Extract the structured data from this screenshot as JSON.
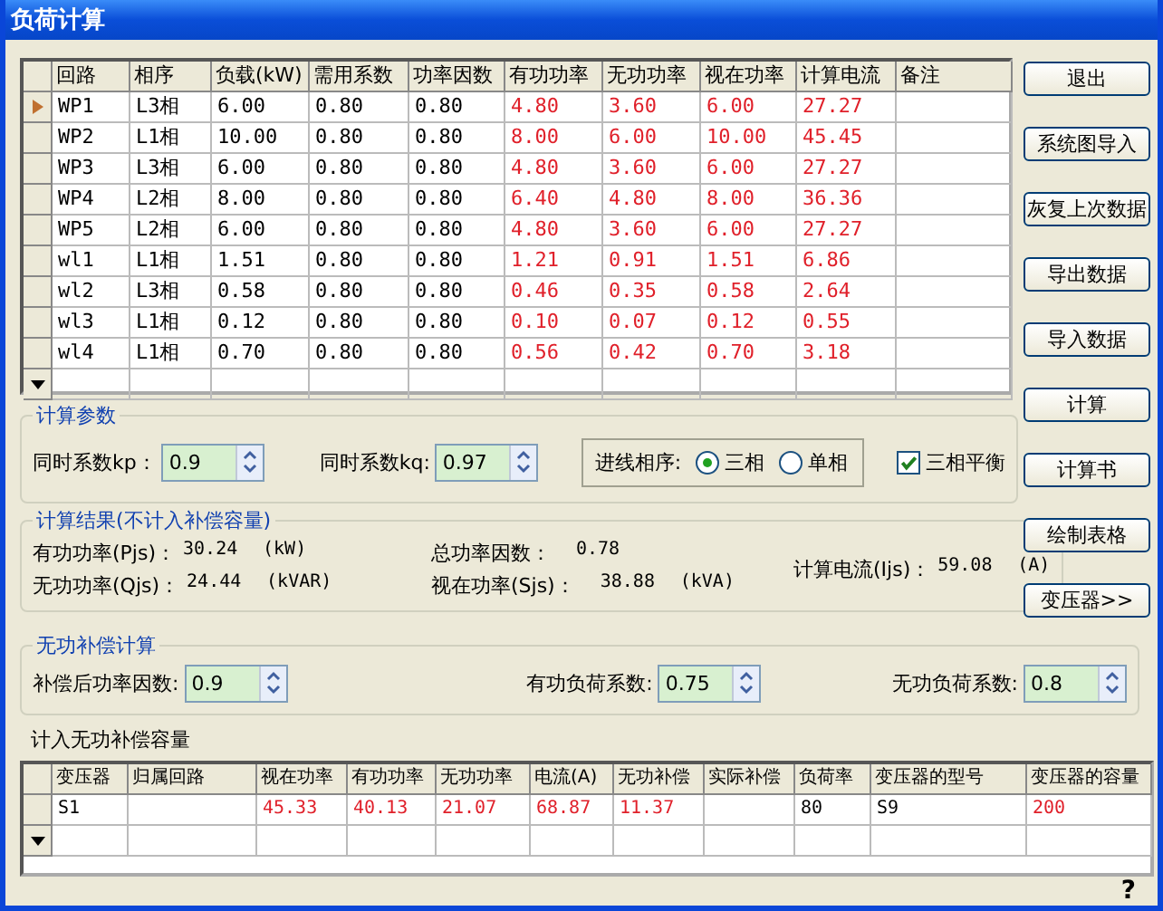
{
  "window": {
    "title": "负荷计算"
  },
  "load_table": {
    "columns": [
      {
        "label": "回路",
        "color": "#000000"
      },
      {
        "label": "相序",
        "color": "#000000"
      },
      {
        "label": "负载(kW)",
        "color": "#000000"
      },
      {
        "label": "需用系数",
        "color": "#000000"
      },
      {
        "label": "功率因数",
        "color": "#000000"
      },
      {
        "label": "有功功率",
        "color": "#e0202a"
      },
      {
        "label": "无功功率",
        "color": "#e0202a"
      },
      {
        "label": "视在功率",
        "color": "#e0202a"
      },
      {
        "label": "计算电流",
        "color": "#e0202a"
      },
      {
        "label": "备注"
      }
    ],
    "rows": [
      {
        "selected": true,
        "cells": [
          "WP1",
          "L3相",
          "6.00",
          "0.80",
          "0.80",
          "4.80",
          "3.60",
          "6.00",
          "27.27",
          null
        ]
      },
      {
        "selected": false,
        "cells": [
          "WP2",
          "L1相",
          "10.00",
          "0.80",
          "0.80",
          "8.00",
          "6.00",
          "10.00",
          "45.45",
          null
        ]
      },
      {
        "selected": false,
        "cells": [
          "WP3",
          "L3相",
          "6.00",
          "0.80",
          "0.80",
          "4.80",
          "3.60",
          "6.00",
          "27.27",
          null
        ]
      },
      {
        "selected": false,
        "cells": [
          "WP4",
          "L2相",
          "8.00",
          "0.80",
          "0.80",
          "6.40",
          "4.80",
          "8.00",
          "36.36",
          null
        ]
      },
      {
        "selected": false,
        "cells": [
          "WP5",
          "L2相",
          "6.00",
          "0.80",
          "0.80",
          "4.80",
          "3.60",
          "6.00",
          "27.27",
          null
        ]
      },
      {
        "selected": false,
        "cells": [
          "wl1",
          "L1相",
          "1.51",
          "0.80",
          "0.80",
          "1.21",
          "0.91",
          "1.51",
          "6.86",
          null
        ]
      },
      {
        "selected": false,
        "cells": [
          "wl2",
          "L3相",
          "0.58",
          "0.80",
          "0.80",
          "0.46",
          "0.35",
          "0.58",
          "2.64",
          null
        ]
      },
      {
        "selected": false,
        "cells": [
          "wl3",
          "L1相",
          "0.12",
          "0.80",
          "0.80",
          "0.10",
          "0.07",
          "0.12",
          "0.55",
          null
        ]
      },
      {
        "selected": false,
        "cells": [
          "wl4",
          "L1相",
          "0.70",
          "0.80",
          "0.80",
          "0.56",
          "0.42",
          "0.70",
          "3.18",
          null
        ]
      }
    ]
  },
  "buttons": [
    {
      "label": "退出"
    },
    {
      "label": "系统图导入"
    },
    {
      "label": "灰复上次数据"
    },
    {
      "label": "导出数据"
    },
    {
      "label": "导入数据"
    },
    {
      "label": "计算"
    },
    {
      "label": "计算书"
    },
    {
      "label": "绘制表格"
    },
    {
      "label": "变压器>>"
    }
  ],
  "params": {
    "title": "计算参数",
    "fields": [
      {
        "label": "同时系数kp：",
        "value": "0.9"
      },
      {
        "label": "同时系数kq:",
        "value": "0.97"
      }
    ],
    "phase": {
      "label": "进线相序:",
      "options": [
        {
          "label": "三相",
          "selected": true
        },
        {
          "label": "单相",
          "selected": false
        }
      ]
    },
    "balance": {
      "label": "三相平衡",
      "checked": true
    }
  },
  "results": {
    "title": "计算结果(不计入补偿容量)",
    "columns": [
      [
        {
          "label": "有功功率(Pjs)：",
          "value": "30.24",
          "unit": "(kW)"
        },
        {
          "label": "无功功率(Qjs)：",
          "value": "24.44",
          "unit": "(kVAR)"
        }
      ],
      [
        {
          "label": "总功率因数：",
          "value": "0.78"
        },
        {
          "label": "视在功率(Sjs)：",
          "value": "38.88",
          "unit": "(kVA)"
        }
      ],
      [
        {
          "label": "计算电流(Ijs)：",
          "value": "59.08",
          "unit": "(A)"
        }
      ]
    ]
  },
  "compensation": {
    "title": "无功补偿计算",
    "fields": [
      {
        "label": "补偿后功率因数:",
        "value": "0.9"
      },
      {
        "label": "有功负荷系数:",
        "value": "0.75"
      },
      {
        "label": "无功负荷系数:",
        "value": "0.8"
      }
    ]
  },
  "transformer_table": {
    "title": "计入无功补偿容量",
    "columns": [
      {
        "label": "变压器",
        "color": "#000000"
      },
      {
        "label": "归属回路"
      },
      {
        "label": "视在功率",
        "color": "#e0202a"
      },
      {
        "label": "有功功率",
        "color": "#e0202a"
      },
      {
        "label": "无功功率",
        "color": "#e0202a"
      },
      {
        "label": "电流(A)",
        "color": "#e0202a"
      },
      {
        "label": "无功补偿",
        "color": "#e0202a"
      },
      {
        "label": "实际补偿"
      },
      {
        "label": "负荷率",
        "color": "#000000"
      },
      {
        "label": "变压器的型号",
        "color": "#000000"
      },
      {
        "label": "变压器的容量",
        "color": "#e0202a"
      }
    ],
    "rows": [
      {
        "selected": false,
        "cells": [
          "S1",
          null,
          "45.33",
          "40.13",
          "21.07",
          "68.87",
          "11.37",
          null,
          "80",
          "S9",
          "200"
        ]
      }
    ]
  },
  "help": "?"
}
